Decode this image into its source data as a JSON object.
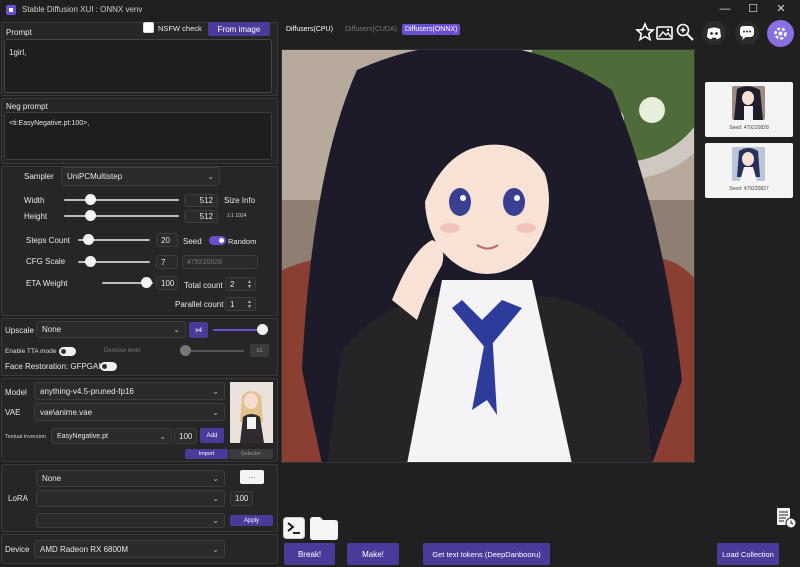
{
  "window": {
    "title": "Stable Diffusion XUI : ONNX venv",
    "minimize": "—",
    "maximize": "☐",
    "close": "✕"
  },
  "prompt": {
    "label": "Prompt",
    "value": "1girl,",
    "nsfw_label": "NSFW check",
    "from_image": "From image"
  },
  "neg_prompt": {
    "label": "Neg prompt",
    "value": "<ti:EasyNegative.pt:100>,"
  },
  "sampler": {
    "label": "Sampler",
    "value": "UniPCMultistep"
  },
  "width": {
    "label": "Width",
    "value": "512",
    "fraction": 0.2
  },
  "height": {
    "label": "Height",
    "value": "512",
    "fraction": 0.2
  },
  "size_info": {
    "label": "Size Info",
    "value": "1:1 1024"
  },
  "steps": {
    "label": "Steps Count",
    "value": "20",
    "fraction": 0.08
  },
  "cfg": {
    "label": "CFG Scale",
    "value": "7",
    "fraction": 0.12
  },
  "eta": {
    "label": "ETA Weight",
    "value": "100",
    "fraction": 0.98
  },
  "seed": {
    "label": "Seed",
    "random_label": "Random",
    "value": "479220828"
  },
  "total_count": {
    "label": "Total count",
    "value": "2"
  },
  "parallel_count": {
    "label": "Parallel count",
    "value": "1"
  },
  "upscale": {
    "label": "Upscale",
    "value": "None",
    "factor": "x4"
  },
  "tta": {
    "label": "Enable TTA mode",
    "denoise_label": "Denoise level",
    "denoise_btn": "x1"
  },
  "face_restoration": {
    "label": "Face Restoration: GFPGAN"
  },
  "model": {
    "label": "Model",
    "value": "anything-v4.5-pruned-fp16"
  },
  "vae": {
    "label": "VAE",
    "value": "vae\\anime.vae"
  },
  "textual_inversion": {
    "label": "Textual inversion",
    "value": "EasyNegative.pt",
    "weight": "100",
    "add": "Add"
  },
  "ti_tabs": {
    "import": "Import",
    "selector": "Selector"
  },
  "lora": {
    "label": "LoRA",
    "value1": "None",
    "value2": "",
    "value3": "",
    "weight": "100",
    "more_btn": "....",
    "apply": "Apply"
  },
  "device": {
    "label": "Device",
    "value": "AMD Radeon RX 6800M"
  },
  "backend_tabs": [
    {
      "label": "Diffusers(CPU)",
      "active": false,
      "disabled": false
    },
    {
      "label": "Diffusers(CUDA)",
      "active": false,
      "disabled": true
    },
    {
      "label": "Diffusers(ONNX)",
      "active": true,
      "disabled": false
    }
  ],
  "history": [
    {
      "seed": "Seed: 479220828"
    },
    {
      "seed": "Seed: 479220827"
    }
  ],
  "actions": {
    "break": "Break!",
    "make": "Make!",
    "tokens": "Get text tokens (DeepDanbooru)",
    "load_collection": "Load Collection"
  },
  "colors": {
    "accent": "#4b3a9a",
    "toggle_on": "#6b4fd0",
    "bg": "#202020",
    "panel": "#262626"
  },
  "icons": [
    "star-icon",
    "image-icon",
    "zoom-icon",
    "discord-icon",
    "chat-icon",
    "settings-icon",
    "terminal-icon",
    "folder-icon",
    "log-icon"
  ]
}
